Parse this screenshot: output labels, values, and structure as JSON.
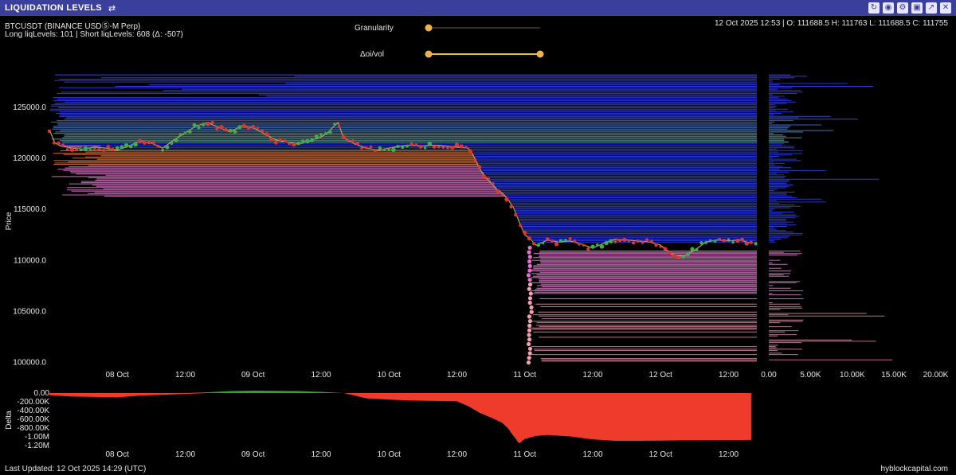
{
  "header": {
    "title": "LIQUIDATION LEVELS",
    "icons": [
      "refresh-icon",
      "camera-icon",
      "gear-icon",
      "save-icon",
      "expand-icon",
      "close-icon"
    ]
  },
  "info": {
    "symbol": "BTCUSDT (BINANCE USDⓈ-M Perp)",
    "levels": "Long liqLevels: 101 | Short liqLevels: 608 (Δ: -507)",
    "ohlc": "12 Oct 2025 12:53 | O: 111688.5 H: 111763 L: 111688.5 C: 111755"
  },
  "controls": {
    "granularity_label": "Granularity",
    "granularity_value": 0.0,
    "delta_label": "Δoi/vol",
    "delta_range": [
      0.0,
      1.0
    ]
  },
  "footer": {
    "last_updated": "Last Updated: 12 Oct 2025 14:29 (UTC)",
    "brand": "hyblockcapital.com"
  },
  "colors": {
    "long_liq": "#e76fd0",
    "short_liq": "#2a35ff",
    "green_band": "#6fb8a0",
    "orange_band": "#e8763c",
    "price_line": "#c0a060",
    "up_candle": "#3fae49",
    "down_candle": "#e0362c",
    "delta_neg": "#ef3b2c",
    "delta_pos": "#3c9a35",
    "slider": "#f0b34a"
  },
  "chart_data": [
    {
      "type": "line",
      "ylabel": "Price",
      "ylim": [
        99500,
        128500
      ],
      "y_ticks": [
        "125000.0",
        "120000.0",
        "115000.0",
        "110000.0",
        "105000.0",
        "100000.0"
      ],
      "y_tick_values": [
        125000,
        120000,
        115000,
        110000,
        105000,
        100000
      ],
      "x_tick_labels": [
        "08 Oct",
        "12:00",
        "09 Oct",
        "12:00",
        "10 Oct",
        "12:00",
        "11 Oct",
        "12:00",
        "12 Oct",
        "12:00"
      ],
      "x_tick_hours": [
        24,
        36,
        48,
        60,
        72,
        84,
        96,
        108,
        120,
        132
      ],
      "x_unit": "hours",
      "xlim": [
        12,
        137
      ],
      "price_series": {
        "name": "",
        "x": [
          12,
          13,
          14,
          16,
          18,
          20,
          22,
          24,
          26,
          28,
          30,
          32,
          34,
          36,
          38,
          40,
          42,
          44,
          46,
          48,
          50,
          52,
          54,
          56,
          58,
          60,
          61,
          62,
          63,
          64,
          66,
          68,
          70,
          72,
          74,
          76,
          78,
          80,
          82,
          84,
          86,
          87,
          88,
          89,
          90,
          91,
          92,
          93,
          94,
          95,
          96,
          97,
          98,
          100,
          102,
          104,
          106,
          108,
          110,
          112,
          114,
          116,
          118,
          120,
          122,
          124,
          126,
          128,
          130,
          132,
          134,
          136
        ],
        "y": [
          122800,
          121500,
          121200,
          121000,
          120900,
          121100,
          121000,
          120800,
          121200,
          121700,
          121500,
          121000,
          121800,
          122500,
          123200,
          123500,
          123000,
          122600,
          123200,
          123000,
          122400,
          121800,
          121600,
          121400,
          121700,
          122100,
          122400,
          123000,
          123500,
          122000,
          121400,
          121000,
          120800,
          121000,
          121200,
          121300,
          121200,
          121300,
          121200,
          121100,
          121000,
          120200,
          119000,
          118200,
          117600,
          117000,
          116600,
          116000,
          115200,
          113800,
          112500,
          112100,
          111500,
          112000,
          111800,
          111900,
          111600,
          111200,
          111700,
          112100,
          112000,
          111900,
          111800,
          111500,
          110600,
          110400,
          111000,
          111800,
          112000,
          111900,
          112000,
          111700
        ]
      },
      "short_liq_levels": {
        "name": "",
        "y_range": [
          111800,
          128300
        ]
      },
      "long_liq_levels": {
        "name": "",
        "y_range": [
          100000,
          111000
        ]
      }
    },
    {
      "type": "bar",
      "orientation": "horizontal",
      "x_ticks": [
        "0.00",
        "5.00K",
        "10.00K",
        "15.00K",
        "20.00K"
      ],
      "x_tick_values": [
        0,
        5000,
        10000,
        15000,
        20000
      ],
      "xlim": [
        0,
        21000
      ]
    },
    {
      "type": "area",
      "ylabel": "Delta",
      "ylim": [
        -1200000,
        0
      ],
      "y_ticks": [
        "0.00",
        "-200.00K",
        "-400.00K",
        "-600.00K",
        "-800.00K",
        "-1.00M",
        "-1.20M"
      ],
      "y_tick_values": [
        0,
        -200000,
        -400000,
        -600000,
        -800000,
        -1000000,
        -1200000
      ],
      "x_tick_labels": [
        "08 Oct",
        "12:00",
        "09 Oct",
        "12:00",
        "10 Oct",
        "12:00",
        "11 Oct",
        "12:00",
        "12 Oct",
        "12:00"
      ],
      "x_tick_hours": [
        24,
        36,
        48,
        60,
        72,
        84,
        96,
        108,
        120,
        132
      ],
      "xlim": [
        12,
        137
      ],
      "series": [
        {
          "name": "",
          "x": [
            12,
            16,
            20,
            24,
            28,
            32,
            36,
            40,
            44,
            48,
            52,
            56,
            60,
            64,
            66,
            68,
            72,
            76,
            80,
            84,
            86,
            88,
            90,
            92,
            93,
            94,
            95,
            96,
            98,
            100,
            104,
            108,
            112,
            116,
            120,
            124,
            128,
            132,
            136
          ],
          "y": [
            -50000,
            -80000,
            -90000,
            -100000,
            -60000,
            -40000,
            -20000,
            20000,
            50000,
            60000,
            55000,
            50000,
            30000,
            0,
            -60000,
            -120000,
            -150000,
            -170000,
            -180000,
            -190000,
            -300000,
            -450000,
            -560000,
            -680000,
            -800000,
            -980000,
            -1150000,
            -1050000,
            -980000,
            -960000,
            -990000,
            -1060000,
            -1090000,
            -1090000,
            -1085000,
            -1080000,
            -1075000,
            -1075000,
            -1070000
          ]
        }
      ]
    }
  ]
}
